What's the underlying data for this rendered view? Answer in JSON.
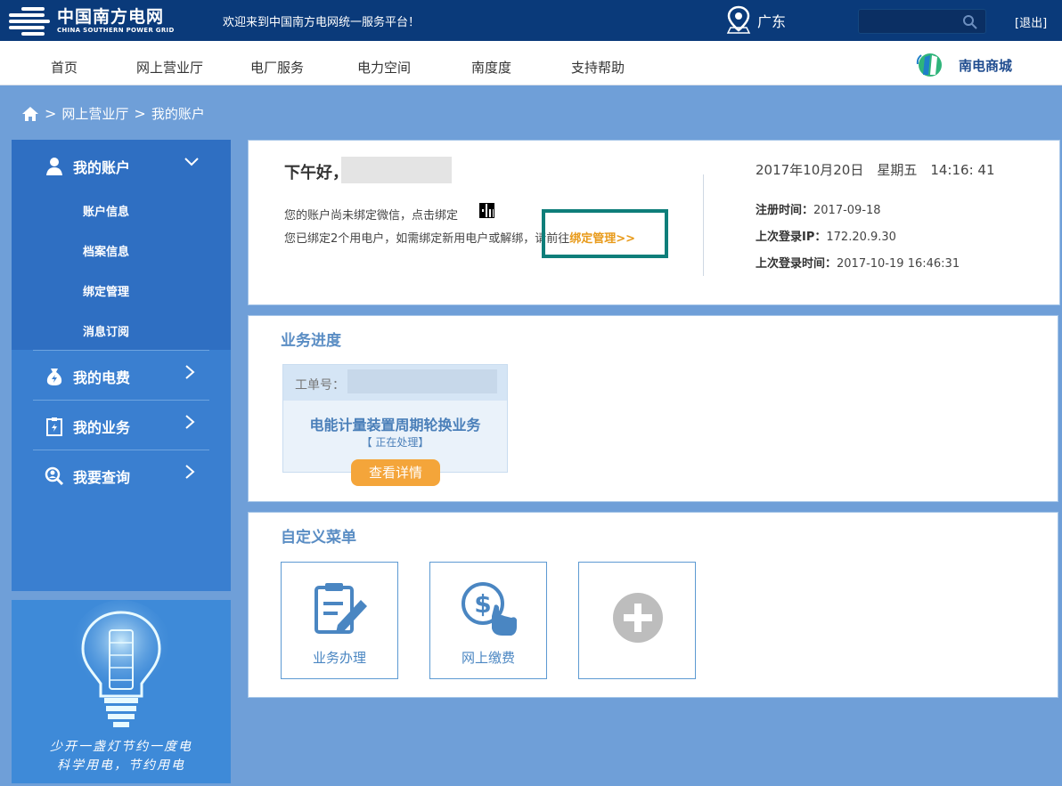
{
  "header": {
    "logo_cn": "中国南方电网",
    "logo_en": "CHINA SOUTHERN POWER GRID",
    "welcome": "欢迎来到中国南方电网统一服务平台！",
    "region": "广东",
    "search_placeholder": "",
    "logout": "[退出]"
  },
  "nav": {
    "items": [
      "首页",
      "网上营业厅",
      "电厂服务",
      "电力空间",
      "南度度",
      "支持帮助"
    ],
    "mall": "南电商城"
  },
  "breadcrumb": {
    "items": [
      "网上营业厅",
      "我的账户"
    ]
  },
  "sidebar": {
    "account": {
      "label": "我的账户",
      "sub": [
        "账户信息",
        "档案信息",
        "绑定管理",
        "消息订阅"
      ]
    },
    "sections": [
      {
        "label": "我的电费"
      },
      {
        "label": "我的业务"
      },
      {
        "label": "我要查询"
      }
    ],
    "promo_lines": [
      "少开一盏灯节约一度电",
      "科学用电，节约用电"
    ]
  },
  "welcome_panel": {
    "greeting": "下午好，",
    "wechat_text": "您的账户尚未绑定微信，点击绑定",
    "bind_text": "您已绑定2个用电户，如需绑定新用电户或解绑，请前往",
    "bind_link": "绑定管理>>",
    "datetime": "2017年10月20日　星期五　14:16: 41",
    "register_label": "注册时间：",
    "register_value": "2017-09-18",
    "last_ip_label": "上次登录IP：",
    "last_ip_value": "172.20.9.30",
    "last_login_label": "上次登录时间：",
    "last_login_value": "2017-10-19 16:46:31"
  },
  "progress_panel": {
    "title": "业务进度",
    "order_label": "工单号：",
    "order_name": "电能计量装置周期轮换业务",
    "order_status": "【 正在处理】",
    "detail_button": "查看详情"
  },
  "custom_menu": {
    "title": "自定义菜单",
    "tiles": [
      {
        "label": "业务办理",
        "icon": "clipboard-edit-icon"
      },
      {
        "label": "网上缴费",
        "icon": "dollar-pay-icon"
      },
      {
        "label": "",
        "icon": "add-icon"
      }
    ]
  },
  "colors": {
    "top_bar": "#0a3a7a",
    "sidebar": "#3a7fd0",
    "background": "#6f9fd8",
    "accent_orange": "#f4a53a",
    "highlight": "#0f7e7a"
  }
}
